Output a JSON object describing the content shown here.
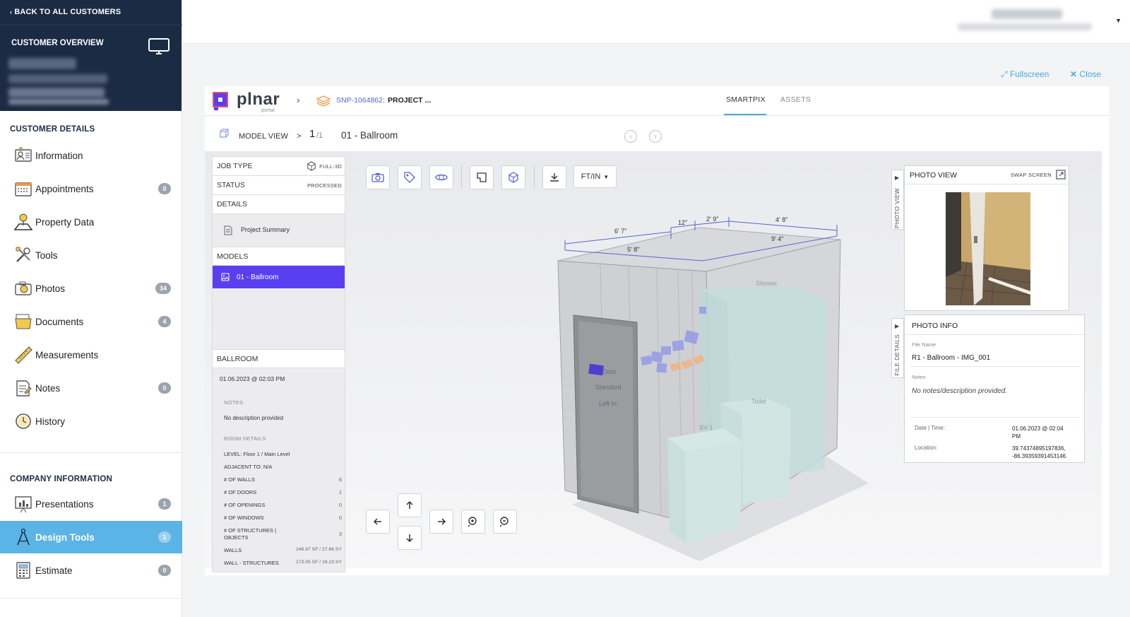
{
  "sidebar": {
    "back_label": "BACK TO ALL CUSTOMERS",
    "overview_title": "CUSTOMER OVERVIEW",
    "customer_details_heading": "CUSTOMER DETAILS",
    "company_info_heading": "COMPANY INFORMATION",
    "items": [
      {
        "label": "Information",
        "icon": "contact-card-icon",
        "badge": ""
      },
      {
        "label": "Appointments",
        "icon": "calendar-icon",
        "badge": "0"
      },
      {
        "label": "Property Data",
        "icon": "map-pin-icon",
        "badge": ""
      },
      {
        "label": "Tools",
        "icon": "tools-icon",
        "badge": ""
      },
      {
        "label": "Photos",
        "icon": "camera-icon",
        "badge": "34"
      },
      {
        "label": "Documents",
        "icon": "folder-icon",
        "badge": "4"
      },
      {
        "label": "Measurements",
        "icon": "ruler-icon",
        "badge": ""
      },
      {
        "label": "Notes",
        "icon": "notes-icon",
        "badge": "0"
      },
      {
        "label": "History",
        "icon": "clock-icon",
        "badge": ""
      }
    ],
    "company_items": [
      {
        "label": "Presentations",
        "icon": "presentation-icon",
        "badge": "1"
      },
      {
        "label": "Design Tools",
        "icon": "compass-icon",
        "badge": "1",
        "active": true
      },
      {
        "label": "Estimate",
        "icon": "calculator-icon",
        "badge": "0"
      }
    ]
  },
  "actions": {
    "fullscreen": "Fullscreen",
    "close": "Close"
  },
  "viewer": {
    "logo_text": "plnar",
    "logo_sub": "portal",
    "project_id": "SNP-1064862:",
    "project_name": "PROJECT ...",
    "tabs": [
      "SMARTPIX",
      "ASSETS"
    ],
    "model_view_label": "MODEL VIEW",
    "page_current": "1",
    "page_total": "/1",
    "room_title": "01 - Ballroom",
    "unit_select": "FT/IN"
  },
  "info_panel": {
    "job_type_label": "JOB TYPE",
    "job_type_value": "FULL-3D",
    "status_label": "STATUS",
    "status_value": "PROCESSED",
    "details_label": "DETAILS",
    "project_summary": "Project Summary",
    "models_label": "MODELS",
    "model_item": "01 - Ballroom",
    "room_label": "BALLROOM",
    "room_date": "01.06.2023 @ 02:03 PM",
    "notes_label": "NOTES",
    "notes_value": "No description provided",
    "room_details_label": "ROOM DETAILS",
    "level": "LEVEL:  Floor 1 / Main Level",
    "adjacent": "ADJACENT TO:  N/A",
    "stats": [
      {
        "label": "# OF WALLS",
        "value": "6"
      },
      {
        "label": "# OF DOORS",
        "value": "1"
      },
      {
        "label": "# OF OPENINGS",
        "value": "0"
      },
      {
        "label": "# OF WINDOWS",
        "value": "0"
      }
    ],
    "structures_label_1": "# OF STRUCTURES |",
    "structures_label_2": "OBJECTS",
    "structures_value": "3",
    "walls_label": "WALLS",
    "walls_value": "248.97 SF / 27.66 SY",
    "wall_struct_label": "WALL - STRUCTURES",
    "wall_struct_value": "173.05 SF / 19.23 SY"
  },
  "model": {
    "dims": [
      "6' 7\"",
      "12\"",
      "2' 9\"",
      "4' 8\"",
      "5' 8\"",
      "9' 4\""
    ],
    "labels": {
      "shower": "Shower",
      "toilet": "Toilet",
      "bv": "BV-1",
      "door1": "Door",
      "door2": "Standard",
      "door3": "Left In"
    }
  },
  "photo_view": {
    "title": "PHOTO VIEW",
    "swap": "SWAP SCREEN",
    "side_tab": "PHOTO VIEW"
  },
  "photo_info": {
    "title": "PHOTO INFO",
    "side_tab": "FILE DETAILS",
    "file_name_label": "File Name",
    "file_name": "R1 - Ballroom - IMG_001",
    "notes_label": "Notes",
    "notes": "No notes/description provided.",
    "datetime_label": "Date | Time:",
    "datetime_1": "01.06.2023 @ 02:04",
    "datetime_2": "PM",
    "location_label": "Location:",
    "location_1": "39.74374895197836,",
    "location_2": "-86.39359391453146"
  }
}
